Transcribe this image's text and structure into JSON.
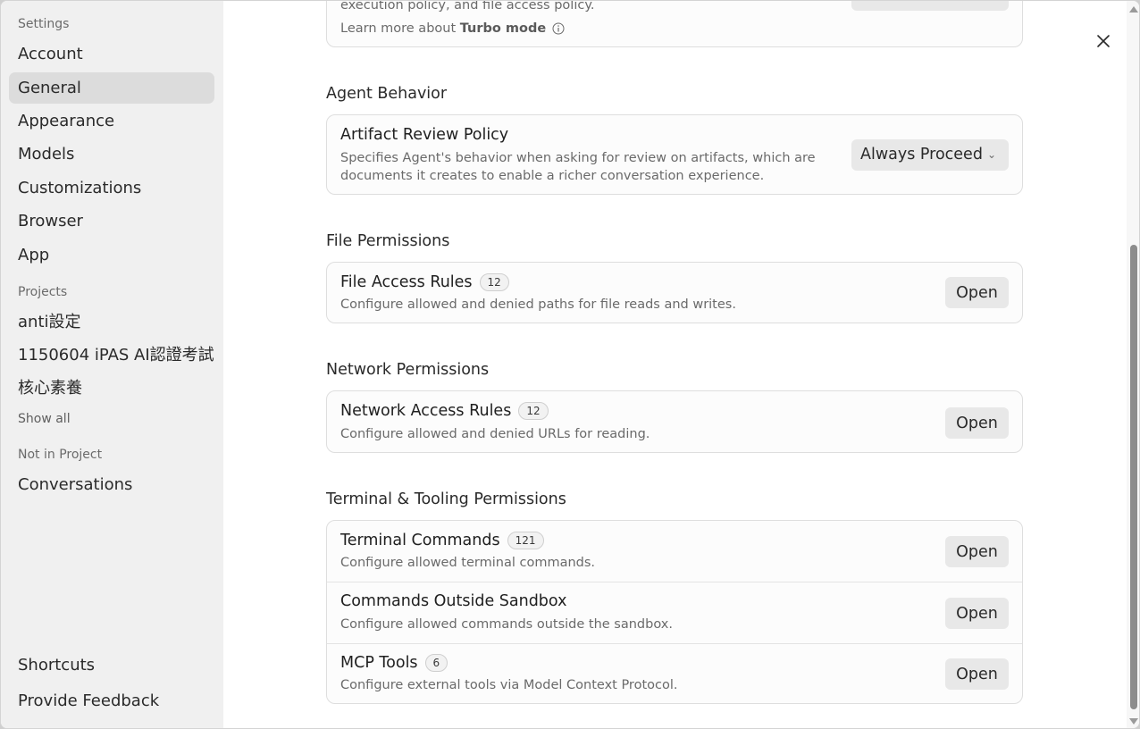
{
  "sidebar": {
    "settings_label": "Settings",
    "items": [
      {
        "label": "Account"
      },
      {
        "label": "General"
      },
      {
        "label": "Appearance"
      },
      {
        "label": "Models"
      },
      {
        "label": "Customizations"
      },
      {
        "label": "Browser"
      },
      {
        "label": "App"
      }
    ],
    "projects_label": "Projects",
    "projects": [
      {
        "label": "anti設定"
      },
      {
        "label": "1150604 iPAS AI認證考試"
      },
      {
        "label": "核心素養"
      }
    ],
    "show_all": "Show all",
    "not_in_project_label": "Not in Project",
    "conversations": "Conversations",
    "shortcuts": "Shortcuts",
    "feedback": "Provide Feedback"
  },
  "top_card": {
    "partial_desc": "execution policy, and file access policy.",
    "learn_more_prefix": "Learn more about ",
    "learn_more_link": "Turbo mode"
  },
  "agent_behavior": {
    "title": "Agent Behavior",
    "artifact_title": "Artifact Review Policy",
    "artifact_desc_1": "Specifies Agent's behavior when asking for review on artifacts, which are",
    "artifact_desc_2": "documents it creates to enable a richer conversation experience.",
    "artifact_value": "Always Proceed"
  },
  "file_permissions": {
    "title": "File Permissions",
    "row_title": "File Access Rules",
    "badge": "12",
    "desc": "Configure allowed and denied paths for file reads and writes.",
    "button": "Open"
  },
  "network_permissions": {
    "title": "Network Permissions",
    "row_title": "Network Access Rules",
    "badge": "12",
    "desc": "Configure allowed and denied URLs for reading.",
    "button": "Open"
  },
  "terminal": {
    "title": "Terminal & Tooling Permissions",
    "rows": [
      {
        "title": "Terminal Commands",
        "badge": "121",
        "desc": "Configure allowed terminal commands.",
        "button": "Open"
      },
      {
        "title": "Commands Outside Sandbox",
        "desc": "Configure allowed commands outside the sandbox.",
        "button": "Open"
      },
      {
        "title": "MCP Tools",
        "badge": "6",
        "desc": "Configure external tools via Model Context Protocol.",
        "button": "Open"
      }
    ]
  }
}
